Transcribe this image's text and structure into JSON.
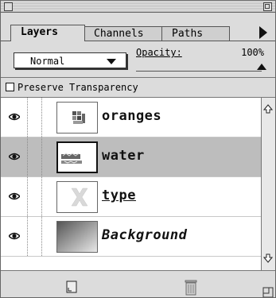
{
  "tabs": [
    {
      "label": "Layers",
      "active": true
    },
    {
      "label": "Channels",
      "active": false
    },
    {
      "label": "Paths",
      "active": false
    }
  ],
  "blend_mode": {
    "selected": "Normal"
  },
  "opacity": {
    "label": "Opacity:",
    "value": "100%"
  },
  "preserve_transparency": {
    "label": "Preserve Transparency",
    "checked": false
  },
  "layers": [
    {
      "name": "oranges",
      "selected": false,
      "visible": true,
      "style": "normal"
    },
    {
      "name": "water",
      "selected": true,
      "visible": true,
      "style": "normal"
    },
    {
      "name": "type",
      "selected": false,
      "visible": true,
      "style": "underline"
    },
    {
      "name": "Background",
      "selected": false,
      "visible": true,
      "style": "italic"
    }
  ],
  "colors": {
    "palette_bg": "#dcdcdc",
    "selection": "#bdbdbd"
  },
  "icons": [
    "close-box-icon",
    "zoom-box-icon",
    "palette-menu-arrow-icon",
    "eye-icon",
    "scroll-up-arrow-icon",
    "scroll-down-arrow-icon",
    "new-layer-icon",
    "trash-icon",
    "resize-icon"
  ]
}
